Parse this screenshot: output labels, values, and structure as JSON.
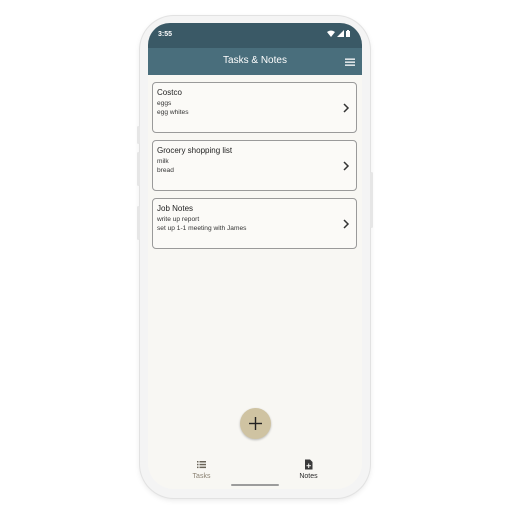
{
  "status_bar": {
    "time": "3:55",
    "icons": [
      "wifi-icon",
      "signal-icon",
      "battery-icon"
    ]
  },
  "app_bar": {
    "title": "Tasks & Notes",
    "menu_icon": "hamburger-menu-icon"
  },
  "notes": [
    {
      "title": "Costco",
      "lines": [
        "eggs",
        "egg whites"
      ]
    },
    {
      "title": "Grocery shopping list",
      "lines": [
        "milk",
        "bread"
      ]
    },
    {
      "title": "Job Notes",
      "lines": [
        "write up report",
        "set up 1-1 meeting with James"
      ]
    }
  ],
  "fab": {
    "icon": "plus-icon"
  },
  "bottom_nav": {
    "items": [
      {
        "label": "Tasks",
        "icon": "list-icon",
        "active": false
      },
      {
        "label": "Notes",
        "icon": "note-add-icon",
        "active": true
      }
    ]
  },
  "colors": {
    "status_bar": "#3a5966",
    "app_bar": "#496e7c",
    "background": "#f8f7f3",
    "fab": "#cfc3a2",
    "inactive_nav": "#8a8172",
    "active_nav": "#2b2b2b"
  }
}
